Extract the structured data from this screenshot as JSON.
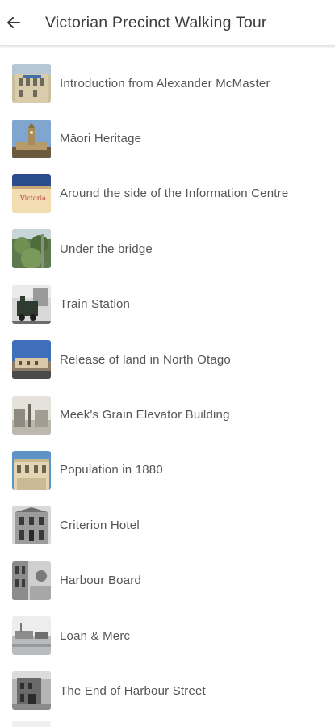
{
  "header": {
    "title": "Victorian Precinct Walking Tour",
    "back_icon": "arrow-left-icon"
  },
  "tour_items": [
    {
      "label": "Introduction from Alexander McMaster",
      "thumb": "building-photo-icon"
    },
    {
      "label": "Māori Heritage",
      "thumb": "clocktower-photo-icon"
    },
    {
      "label": "Around the side of the Information Centre",
      "thumb": "sign-photo-icon"
    },
    {
      "label": "Under the bridge",
      "thumb": "garden-photo-icon"
    },
    {
      "label": "Train Station",
      "thumb": "train-photo-icon"
    },
    {
      "label": "Release of land in North Otago",
      "thumb": "street-photo-icon"
    },
    {
      "label": "Meek's Grain Elevator Building",
      "thumb": "historic-street-photo-icon"
    },
    {
      "label": "Population in 1880",
      "thumb": "stone-building-photo-icon"
    },
    {
      "label": "Criterion Hotel",
      "thumb": "hotel-photo-icon"
    },
    {
      "label": "Harbour Board",
      "thumb": "harbour-board-photo-icon"
    },
    {
      "label": "Loan & Merc",
      "thumb": "harbour-photo-icon"
    },
    {
      "label": "The End of Harbour Street",
      "thumb": "street-end-photo-icon"
    }
  ],
  "colors": {
    "text": "#555555",
    "title": "#3c3c3c",
    "background": "#ffffff",
    "divider": "#e2e2e2"
  }
}
